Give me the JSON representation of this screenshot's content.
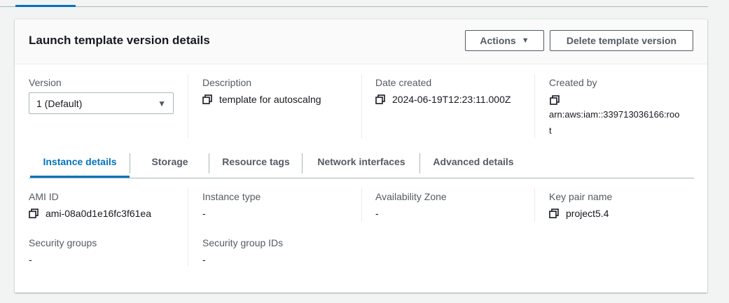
{
  "card": {
    "title": "Launch template version details",
    "actions_label": "Actions",
    "delete_label": "Delete template version"
  },
  "version": {
    "label": "Version",
    "selected": "1 (Default)"
  },
  "description": {
    "label": "Description",
    "value": "template for autoscalng"
  },
  "date_created": {
    "label": "Date created",
    "value": "2024-06-19T12:23:11.000Z"
  },
  "created_by": {
    "label": "Created by",
    "value_line1": "arn:aws:iam::339713036166:roo",
    "value_line2": "t"
  },
  "tabs": [
    {
      "label": "Instance details",
      "active": true
    },
    {
      "label": "Storage",
      "active": false
    },
    {
      "label": "Resource tags",
      "active": false
    },
    {
      "label": "Network interfaces",
      "active": false
    },
    {
      "label": "Advanced details",
      "active": false
    }
  ],
  "instance_details": {
    "ami_id": {
      "label": "AMI ID",
      "value": "ami-08a0d1e16fc3f61ea"
    },
    "instance_type": {
      "label": "Instance type",
      "value": "-"
    },
    "availability_zone": {
      "label": "Availability Zone",
      "value": "-"
    },
    "key_pair_name": {
      "label": "Key pair name",
      "value": "project5.4"
    },
    "security_groups": {
      "label": "Security groups",
      "value": "-"
    },
    "security_group_ids": {
      "label": "Security group IDs",
      "value": "-"
    }
  },
  "colors": {
    "accent": "#0073bb",
    "text": "#16191f",
    "muted": "#545b64",
    "background": "#f2f3f3"
  },
  "icons": {
    "copy": "copy-icon",
    "caret": "caret-down-icon"
  }
}
